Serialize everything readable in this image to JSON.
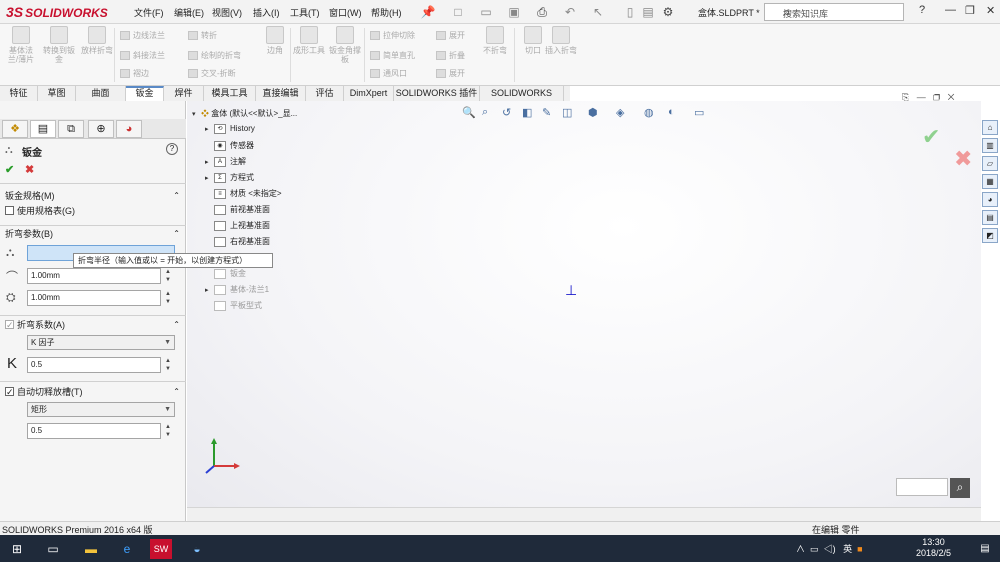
{
  "titlebar": {
    "logo_prefix": "3S",
    "logo_text": "SOLIDWORKS",
    "menus": [
      "文件(F)",
      "编辑(E)",
      "视图(V)",
      "插入(I)",
      "工具(T)",
      "窗口(W)",
      "帮助(H)"
    ],
    "doc_title": "盒体.SLDPRT *",
    "search_placeholder": "搜索知识库",
    "help": "?",
    "minimize": "—",
    "restore": "❐",
    "close": "✕"
  },
  "ribbon": {
    "big_buttons": [
      "基体法兰/薄片",
      "转换到钣金",
      "放样折弯",
      "边角",
      "成形工具",
      "钣金角撑板",
      "切口",
      "插入折弯",
      "不折弯"
    ],
    "small_buttons": [
      "边线法兰",
      "斜接法兰",
      "褶边",
      "转折",
      "绘制的折弯",
      "交叉-折断",
      "拉伸切除",
      "简单直孔",
      "通风口",
      "展开",
      "折叠",
      "展开"
    ]
  },
  "tabs": [
    "特征",
    "草图",
    "曲面",
    "钣金",
    "焊件",
    "模具工具",
    "直接编辑",
    "评估",
    "DimXpert",
    "SOLIDWORKS 插件",
    "SOLIDWORKS MBD"
  ],
  "left_panel": {
    "title": "钣金",
    "help": "?",
    "ok": "✔",
    "cancel": "✖",
    "sec_gauge": "钣金规格(M)",
    "use_gauge": "使用规格表(G)",
    "sec_bend": "折弯参数(B)",
    "bend_radius": "1.00mm",
    "thickness": "1.00mm",
    "tooltip": "折弯半径（输入值或以 = 开始，以创建方程式）",
    "sec_allowance": "折弯系数(A)",
    "allowance_type": "K 因子",
    "k_label": "K",
    "k_value": "0.5",
    "sec_relief": "自动切释放槽(T)",
    "relief_type": "矩形",
    "relief_ratio": "0.5"
  },
  "tree": {
    "root": "盒体 (默认<<默认>_显...",
    "items": [
      "History",
      "传感器",
      "注解",
      "方程式",
      "材质 <未指定>",
      "前视基准面",
      "上视基准面",
      "右视基准面",
      "原点",
      "钣金",
      "基体-法兰1",
      "平板型式"
    ]
  },
  "statusbar": {
    "left": "SOLIDWORKS Premium 2016 x64 版",
    "right": "在编辑 零件"
  },
  "taskbar": {
    "time": "13:30",
    "date": "2018/2/5",
    "ime": "英"
  }
}
